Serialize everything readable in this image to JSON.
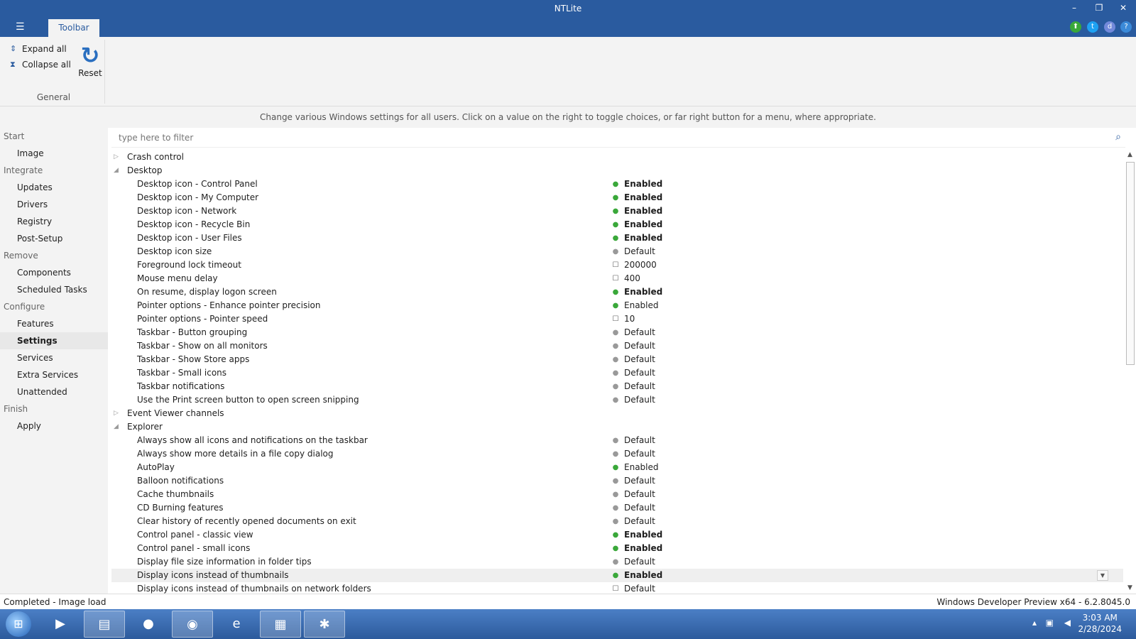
{
  "window": {
    "title": "NTLite",
    "menu_icon": "hamburger-icon",
    "tab": "Toolbar"
  },
  "ribbon": {
    "expand_all": "Expand all",
    "collapse_all": "Collapse all",
    "reset": "Reset",
    "group_label": "General"
  },
  "description": "Change various Windows settings for all users. Click on a value on the right to toggle choices, or far right button for a menu, where appropriate.",
  "filter": {
    "placeholder": "type here to filter"
  },
  "sidebar": [
    {
      "label": "Start",
      "type": "cat"
    },
    {
      "label": "Image",
      "type": "sub"
    },
    {
      "label": "Integrate",
      "type": "cat"
    },
    {
      "label": "Updates",
      "type": "sub"
    },
    {
      "label": "Drivers",
      "type": "sub"
    },
    {
      "label": "Registry",
      "type": "sub"
    },
    {
      "label": "Post-Setup",
      "type": "sub"
    },
    {
      "label": "Remove",
      "type": "cat"
    },
    {
      "label": "Components",
      "type": "sub"
    },
    {
      "label": "Scheduled Tasks",
      "type": "sub"
    },
    {
      "label": "Configure",
      "type": "cat"
    },
    {
      "label": "Features",
      "type": "sub"
    },
    {
      "label": "Settings",
      "type": "sub",
      "selected": true
    },
    {
      "label": "Services",
      "type": "sub"
    },
    {
      "label": "Extra Services",
      "type": "sub"
    },
    {
      "label": "Unattended",
      "type": "sub"
    },
    {
      "label": "Finish",
      "type": "cat"
    },
    {
      "label": "Apply",
      "type": "sub"
    }
  ],
  "rows": [
    {
      "kind": "group",
      "label": "Crash control",
      "expanded": false
    },
    {
      "kind": "group",
      "label": "Desktop",
      "expanded": true
    },
    {
      "kind": "item",
      "label": "Desktop icon - Control Panel",
      "status": "green",
      "value": "Enabled",
      "bold": true
    },
    {
      "kind": "item",
      "label": "Desktop icon - My Computer",
      "status": "green",
      "value": "Enabled",
      "bold": true
    },
    {
      "kind": "item",
      "label": "Desktop icon - Network",
      "status": "green",
      "value": "Enabled",
      "bold": true
    },
    {
      "kind": "item",
      "label": "Desktop icon - Recycle Bin",
      "status": "green",
      "value": "Enabled",
      "bold": true
    },
    {
      "kind": "item",
      "label": "Desktop icon - User Files",
      "status": "green",
      "value": "Enabled",
      "bold": true
    },
    {
      "kind": "item",
      "label": "Desktop icon size",
      "status": "gray",
      "value": "Default",
      "bold": false
    },
    {
      "kind": "item",
      "label": "Foreground lock timeout",
      "status": "box",
      "value": "200000",
      "bold": false
    },
    {
      "kind": "item",
      "label": "Mouse menu delay",
      "status": "box",
      "value": "400",
      "bold": false
    },
    {
      "kind": "item",
      "label": "On resume, display logon screen",
      "status": "green",
      "value": "Enabled",
      "bold": true
    },
    {
      "kind": "item",
      "label": "Pointer options - Enhance pointer precision",
      "status": "green",
      "value": "Enabled",
      "bold": false
    },
    {
      "kind": "item",
      "label": "Pointer options - Pointer speed",
      "status": "box",
      "value": "10",
      "bold": false
    },
    {
      "kind": "item",
      "label": "Taskbar - Button grouping",
      "status": "gray",
      "value": "Default",
      "bold": false
    },
    {
      "kind": "item",
      "label": "Taskbar - Show on all monitors",
      "status": "gray",
      "value": "Default",
      "bold": false
    },
    {
      "kind": "item",
      "label": "Taskbar - Show Store apps",
      "status": "gray",
      "value": "Default",
      "bold": false
    },
    {
      "kind": "item",
      "label": "Taskbar - Small icons",
      "status": "gray",
      "value": "Default",
      "bold": false
    },
    {
      "kind": "item",
      "label": "Taskbar notifications",
      "status": "gray",
      "value": "Default",
      "bold": false
    },
    {
      "kind": "item",
      "label": "Use the Print screen button to open screen snipping",
      "status": "gray",
      "value": "Default",
      "bold": false
    },
    {
      "kind": "group",
      "label": "Event Viewer channels",
      "expanded": false
    },
    {
      "kind": "group",
      "label": "Explorer",
      "expanded": true
    },
    {
      "kind": "item",
      "label": "Always show all icons and notifications on the taskbar",
      "status": "gray",
      "value": "Default",
      "bold": false
    },
    {
      "kind": "item",
      "label": "Always show more details in a file copy dialog",
      "status": "gray",
      "value": "Default",
      "bold": false
    },
    {
      "kind": "item",
      "label": "AutoPlay",
      "status": "green",
      "value": "Enabled",
      "bold": false
    },
    {
      "kind": "item",
      "label": "Balloon notifications",
      "status": "gray",
      "value": "Default",
      "bold": false
    },
    {
      "kind": "item",
      "label": "Cache thumbnails",
      "status": "gray",
      "value": "Default",
      "bold": false
    },
    {
      "kind": "item",
      "label": "CD Burning features",
      "status": "gray",
      "value": "Default",
      "bold": false
    },
    {
      "kind": "item",
      "label": "Clear history of recently opened documents on exit",
      "status": "gray",
      "value": "Default",
      "bold": false
    },
    {
      "kind": "item",
      "label": "Control panel - classic view",
      "status": "green",
      "value": "Enabled",
      "bold": true
    },
    {
      "kind": "item",
      "label": "Control panel - small icons",
      "status": "green",
      "value": "Enabled",
      "bold": true
    },
    {
      "kind": "item",
      "label": "Display file size information in folder tips",
      "status": "gray",
      "value": "Default",
      "bold": false
    },
    {
      "kind": "item",
      "label": "Display icons instead of thumbnails",
      "status": "green",
      "value": "Enabled",
      "bold": true,
      "highlight": true,
      "dropdown": true
    },
    {
      "kind": "item",
      "label": "Display icons instead of thumbnails on network folders",
      "status": "box",
      "value": "Default",
      "bold": false
    }
  ],
  "statusbar": {
    "left": "Completed - Image load",
    "right": "Windows Developer Preview x64 - 6.2.8045.0"
  },
  "taskbar": {
    "apps": [
      {
        "name": "media-player-icon",
        "glyph": "▶"
      },
      {
        "name": "file-explorer-icon",
        "glyph": "▤"
      },
      {
        "name": "chat-app-icon",
        "glyph": "●"
      },
      {
        "name": "firefox-icon",
        "glyph": "◉"
      },
      {
        "name": "internet-explorer-icon",
        "glyph": "e"
      },
      {
        "name": "ntlite-app-icon",
        "glyph": "▦"
      },
      {
        "name": "gecko-app-icon",
        "glyph": "✱"
      }
    ],
    "clock_time": "3:03 AM",
    "clock_date": "2/28/2024"
  },
  "colors": {
    "titlebar": "#2a5b9f",
    "enabled_dot": "#3aa83a",
    "default_dot": "#999999"
  }
}
